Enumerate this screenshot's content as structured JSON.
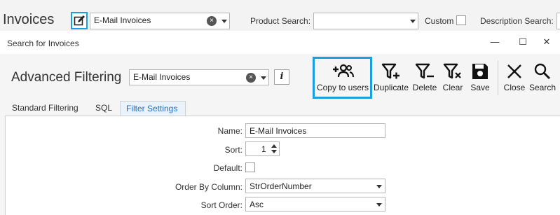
{
  "background": {
    "title": "Invoices",
    "filter_combo_value": "E-Mail Invoices",
    "product_search_label": "Product Search:",
    "product_search_value": "",
    "custom_label": "Custom",
    "description_search_label": "Description Search:"
  },
  "dialog": {
    "title": "Search for Invoices",
    "window_controls": {
      "minimize": "—",
      "maximize": "☐",
      "close": "✕"
    },
    "heading": "Advanced Filtering",
    "filter_combo_value": "E-Mail Invoices",
    "info_button": "i",
    "toolbar": [
      {
        "label": "Copy to users",
        "icon": "copy-to-users-icon"
      },
      {
        "label": "Duplicate",
        "icon": "filter-plus-icon"
      },
      {
        "label": "Delete",
        "icon": "filter-minus-icon"
      },
      {
        "label": "Clear",
        "icon": "filter-clear-icon"
      },
      {
        "label": "Save",
        "icon": "floppy-disk-icon"
      },
      {
        "label": "Close",
        "icon": "close-icon"
      },
      {
        "label": "Search",
        "icon": "search-icon"
      }
    ],
    "tabs": [
      {
        "label": "Standard Filtering",
        "active": false
      },
      {
        "label": "SQL",
        "active": false
      },
      {
        "label": "Filter Settings",
        "active": true
      }
    ],
    "form": {
      "name_label": "Name:",
      "name_value": "E-Mail Invoices",
      "sort_label": "Sort:",
      "sort_value": "1",
      "default_label": "Default:",
      "default_checked": false,
      "order_by_label": "Order By Column:",
      "order_by_value": "StrOrderNumber",
      "sort_order_label": "Sort Order:",
      "sort_order_value": "Asc"
    }
  },
  "colors": {
    "accent": "#1a9fe0",
    "active_tab_text": "#1c6fc7"
  }
}
